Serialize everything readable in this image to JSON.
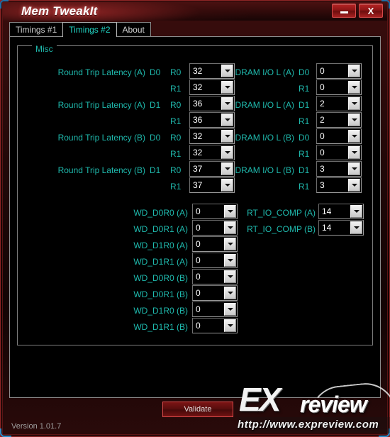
{
  "window": {
    "title": "Mem TweakIt",
    "minimize_label": "minimize",
    "close_label": "X"
  },
  "tabs": [
    {
      "label": "Timings #1",
      "active": false
    },
    {
      "label": "Timings #2",
      "active": true
    },
    {
      "label": "About",
      "active": false
    }
  ],
  "group": {
    "legend": "Misc"
  },
  "left_section": {
    "groups": [
      {
        "label": "Round Trip Latency (A)",
        "dimm": "D0",
        "ranks": [
          {
            "rank": "R0",
            "value": "32"
          },
          {
            "rank": "R1",
            "value": "32"
          }
        ]
      },
      {
        "label": "Round Trip Latency (A)",
        "dimm": "D1",
        "ranks": [
          {
            "rank": "R0",
            "value": "36"
          },
          {
            "rank": "R1",
            "value": "36"
          }
        ]
      },
      {
        "label": "Round Trip Latency (B)",
        "dimm": "D0",
        "ranks": [
          {
            "rank": "R0",
            "value": "32"
          },
          {
            "rank": "R1",
            "value": "32"
          }
        ]
      },
      {
        "label": "Round Trip Latency (B)",
        "dimm": "D1",
        "ranks": [
          {
            "rank": "R0",
            "value": "37"
          },
          {
            "rank": "R1",
            "value": "37"
          }
        ]
      }
    ]
  },
  "right_section": {
    "groups": [
      {
        "label": "DRAM I/O L (A)",
        "dimm": "D0",
        "ranks": [
          {
            "rank": "R0",
            "value": "0"
          },
          {
            "rank": "R1",
            "value": "0"
          }
        ]
      },
      {
        "label": "DRAM I/O L (A)",
        "dimm": "D1",
        "ranks": [
          {
            "rank": "R0",
            "value": "2"
          },
          {
            "rank": "R1",
            "value": "2"
          }
        ]
      },
      {
        "label": "DRAM I/O L (B)",
        "dimm": "D0",
        "ranks": [
          {
            "rank": "R0",
            "value": "0"
          },
          {
            "rank": "R1",
            "value": "0"
          }
        ]
      },
      {
        "label": "DRAM I/O L (B)",
        "dimm": "D1",
        "ranks": [
          {
            "rank": "R0",
            "value": "3"
          },
          {
            "rank": "R1",
            "value": "3"
          }
        ]
      }
    ]
  },
  "wd_section": [
    {
      "label": "WD_D0R0 (A)",
      "value": "0"
    },
    {
      "label": "WD_D0R1 (A)",
      "value": "0"
    },
    {
      "label": "WD_D1R0 (A)",
      "value": "0"
    },
    {
      "label": "WD_D1R1 (A)",
      "value": "0"
    },
    {
      "label": "WD_D0R0 (B)",
      "value": "0"
    },
    {
      "label": "WD_D0R1 (B)",
      "value": "0"
    },
    {
      "label": "WD_D1R0 (B)",
      "value": "0"
    },
    {
      "label": "WD_D1R1 (B)",
      "value": "0"
    }
  ],
  "rt_io_comp_section": [
    {
      "label": "RT_IO_COMP (A)",
      "value": "14"
    },
    {
      "label": "RT_IO_COMP (B)",
      "value": "14"
    }
  ],
  "footer": {
    "validate_label": "Validate",
    "version": "Version 1.01.7"
  },
  "watermark": {
    "brand_ex": "EX",
    "brand_review": "review",
    "url": "http://www.expreview.com"
  },
  "colors": {
    "label": "#1fb9ad",
    "accent_red": "#8f2626",
    "active_tab_text": "#22d7c6",
    "combo_text": "#ffffff"
  }
}
